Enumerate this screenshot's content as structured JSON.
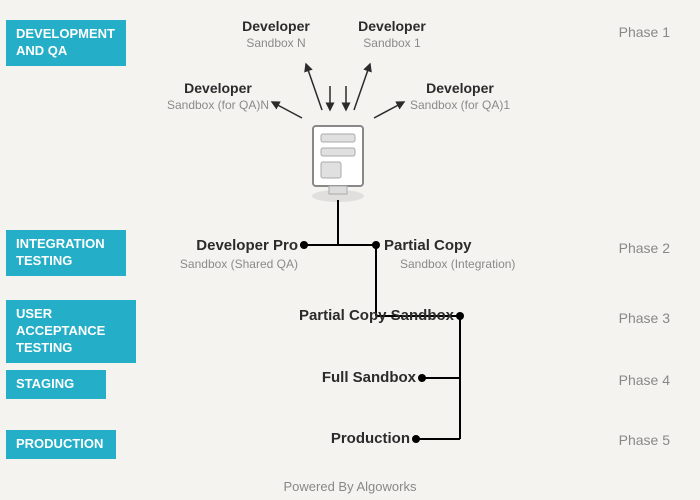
{
  "tags": {
    "dev_qa": "DEVELOPMENT\nAND QA",
    "integration": "INTEGRATION\nTESTING",
    "uat": "USER ACCEPTANCE\nTESTING",
    "staging": "STAGING",
    "production": "PRODUCTION"
  },
  "phases": {
    "p1": "Phase 1",
    "p2": "Phase 2",
    "p3": "Phase 3",
    "p4": "Phase 4",
    "p5": "Phase 5"
  },
  "top": {
    "dev_n_title": "Developer",
    "dev_n_sub": "Sandbox N",
    "dev_1_title": "Developer",
    "dev_1_sub": "Sandbox 1",
    "qa_n_title": "Developer",
    "qa_n_sub": "Sandbox (for QA)N",
    "qa_1_title": "Developer",
    "qa_1_sub": "Sandbox (for QA)1"
  },
  "nodes": {
    "devpro_title": "Developer Pro",
    "devpro_sub": "Sandbox (Shared QA)",
    "partial_title": "Partial Copy",
    "partial_sub": "Sandbox (Integration)",
    "uat_title": "Partial Copy Sandbox",
    "staging_title": "Full Sandbox",
    "prod_title": "Production"
  },
  "footer": "Powered By Algoworks"
}
